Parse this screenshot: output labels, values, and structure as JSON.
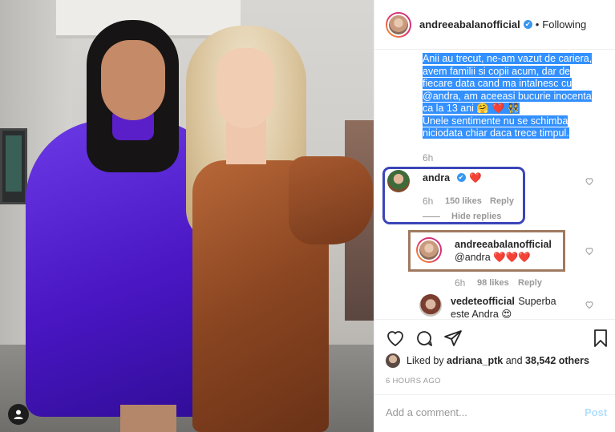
{
  "header": {
    "username": "andreeabalanofficial",
    "verified_mark": "✔",
    "separator": "•",
    "follow_status": "Following"
  },
  "caption": {
    "line1": "Anii au trecut, ne-am vazut de cariera,",
    "line2": "avem familii si copii acum, dar de",
    "line3": "fiecare data cand ma intalnesc cu",
    "line4": "@andra, am aceeasi bucurie inocenta",
    "line5": "ca la 13 ani 🤗 ❤️ 👯",
    "line6": "Unele sentimente nu se schimba",
    "line7": "niciodata chiar daca trece timpul.",
    "time": "6h"
  },
  "comments": [
    {
      "username": "andra",
      "verified_mark": "✔",
      "text": "❤️",
      "time": "6h",
      "likes": "150 likes",
      "reply": "Reply",
      "hide_replies": "Hide replies"
    },
    {
      "username": "andreeabalanofficial",
      "text": "@andra ❤️❤️❤️",
      "time": "6h",
      "likes": "98 likes",
      "reply": "Reply"
    },
    {
      "username": "vedeteofficial",
      "text": "Superba este Andra 😍"
    }
  ],
  "footer": {
    "liked_prefix": "Liked by",
    "liked_user": "adriana_ptk",
    "liked_and": "and",
    "liked_count": "38,542 others",
    "time_ago": "6 HOURS AGO",
    "comment_placeholder": "Add a comment...",
    "post_label": "Post"
  },
  "icons": [
    "heart-icon",
    "comment-icon",
    "share-icon",
    "bookmark-icon",
    "verified-icon",
    "user-icon"
  ],
  "colors": {
    "selection": "#3390ff",
    "verified": "#3897f0",
    "highlight_box_blue": "#3b45b8",
    "highlight_box_brown": "#a07a60",
    "post_disabled": "#b2dffc"
  }
}
